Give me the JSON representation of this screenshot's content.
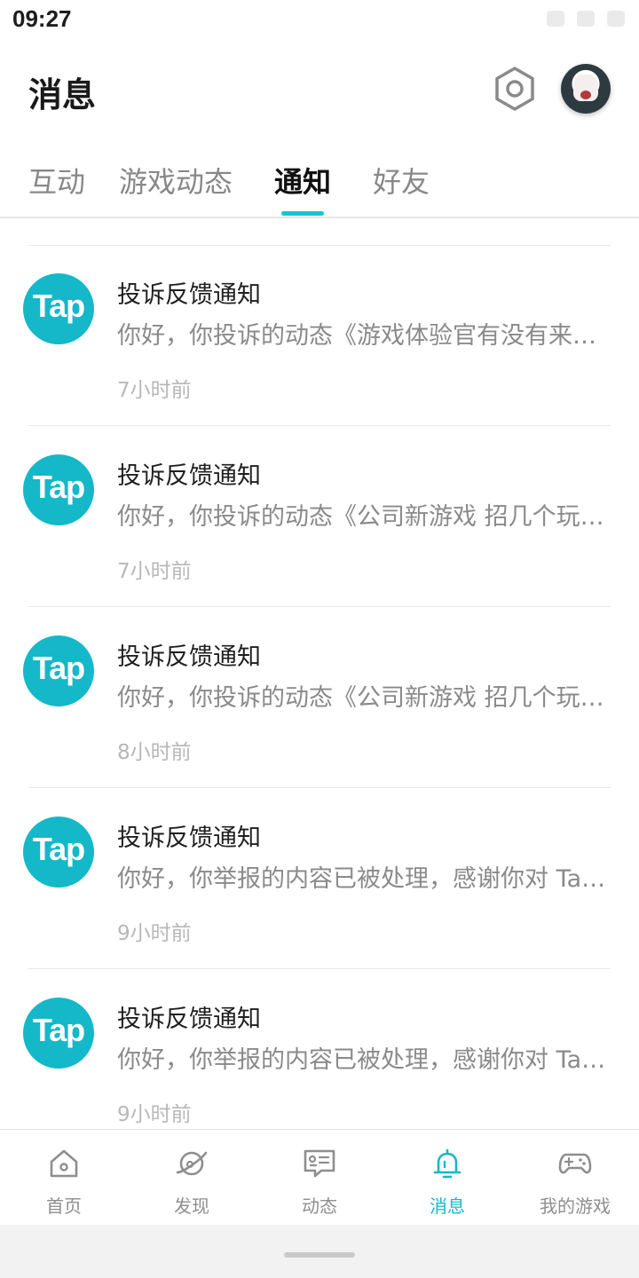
{
  "status_bar": {
    "time": "09:27"
  },
  "header": {
    "title": "消息"
  },
  "tabs": [
    {
      "label": "互动"
    },
    {
      "label": "游戏动态"
    },
    {
      "label": "通知",
      "active": true
    },
    {
      "label": "好友"
    }
  ],
  "notifications": [
    {
      "logo": "Tap",
      "title": "投诉反馈通知",
      "body": "你好，你投诉的动态《游戏体验官有没有来一起玩游戏的》已被处理",
      "time": "7小时前"
    },
    {
      "logo": "Tap",
      "title": "投诉反馈通知",
      "body": "你好，你投诉的动态《公司新游戏 招几个玩家体验》已被处理",
      "time": "7小时前"
    },
    {
      "logo": "Tap",
      "title": "投诉反馈通知",
      "body": "你好，你投诉的动态《公司新游戏 招几个玩家体验》已被处理",
      "time": "8小时前"
    },
    {
      "logo": "Tap",
      "title": "投诉反馈通知",
      "body": "你好，你举报的内容已被处理，感谢你对 TapTap 社区的支持",
      "time": "9小时前"
    },
    {
      "logo": "Tap",
      "title": "投诉反馈通知",
      "body": "你好，你举报的内容已被处理，感谢你对 TapTap 社区的支持",
      "time": "9小时前"
    }
  ],
  "bottom_nav": [
    {
      "label": "首页",
      "icon": "home-icon"
    },
    {
      "label": "发现",
      "icon": "planet-icon"
    },
    {
      "label": "动态",
      "icon": "feed-icon"
    },
    {
      "label": "消息",
      "icon": "bell-icon",
      "active": true
    },
    {
      "label": "我的游戏",
      "icon": "gamepad-icon"
    }
  ],
  "colors": {
    "accent": "#14b8c8",
    "text_primary": "#1f1f1f",
    "text_secondary": "#8a8a8a",
    "text_muted": "#b8b8b8"
  }
}
